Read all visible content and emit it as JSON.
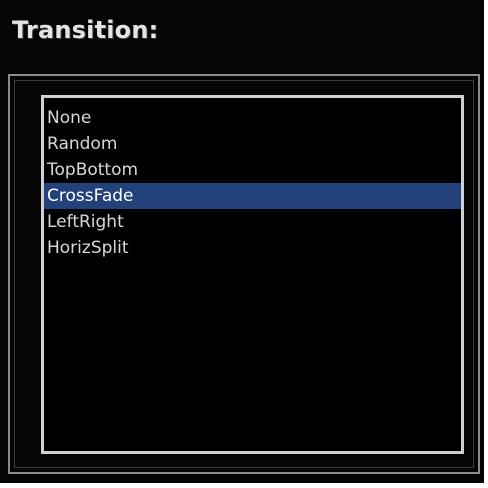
{
  "panel": {
    "title": "Transition:"
  },
  "transition_list": {
    "items": [
      "None",
      "Random",
      "TopBottom",
      "CrossFade",
      "LeftRight",
      "HorizSplit"
    ],
    "selected_index": 3,
    "selected_value": "CrossFade"
  },
  "colors": {
    "background": "#050505",
    "selection": "#23417a",
    "text": "#d8d8d8",
    "frame": "#d0d0d0"
  }
}
